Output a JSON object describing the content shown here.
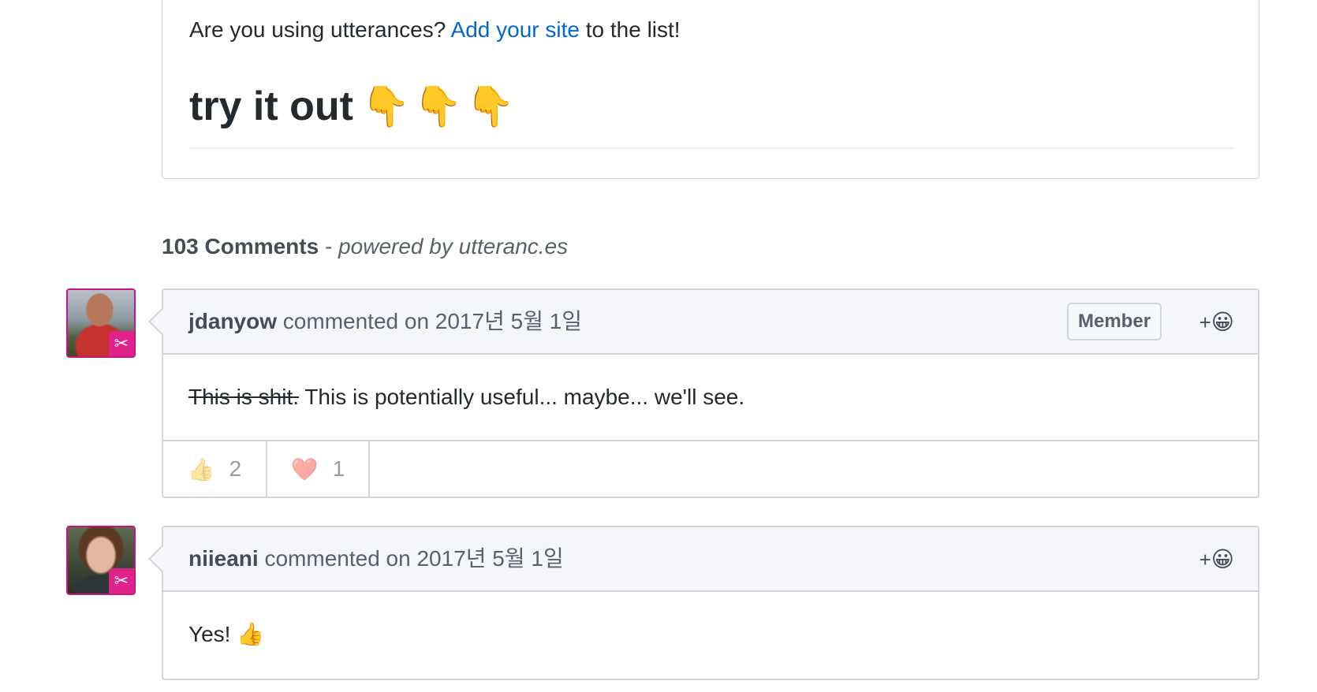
{
  "readme": {
    "usage_prefix": "Are you using utterances?",
    "usage_link": "Add your site",
    "usage_suffix": "to the list!",
    "try_heading": "try it out",
    "try_emoji": "👇👇👇"
  },
  "comments_header": {
    "count": "103 Comments",
    "separator": "-",
    "powered_by": "powered by utteranc.es"
  },
  "comments": [
    {
      "author": "jdanyow",
      "action": "commented on 2017년 5월 1일",
      "association": "Member",
      "add_reaction_plus": "+",
      "add_reaction_icon": "😀",
      "body_struck": "This is shit.",
      "body_text": "This is potentially useful... maybe... we'll see.",
      "reactions": [
        {
          "emoji": "👍",
          "count": "2"
        },
        {
          "emoji": "❤️",
          "count": "1"
        }
      ],
      "badge_icon": "✂"
    },
    {
      "author": "niieani",
      "action": "commented on 2017년 5월 1일",
      "add_reaction_plus": "+",
      "add_reaction_icon": "😀",
      "body_text": "Yes! 👍",
      "badge_icon": "✂"
    }
  ]
}
